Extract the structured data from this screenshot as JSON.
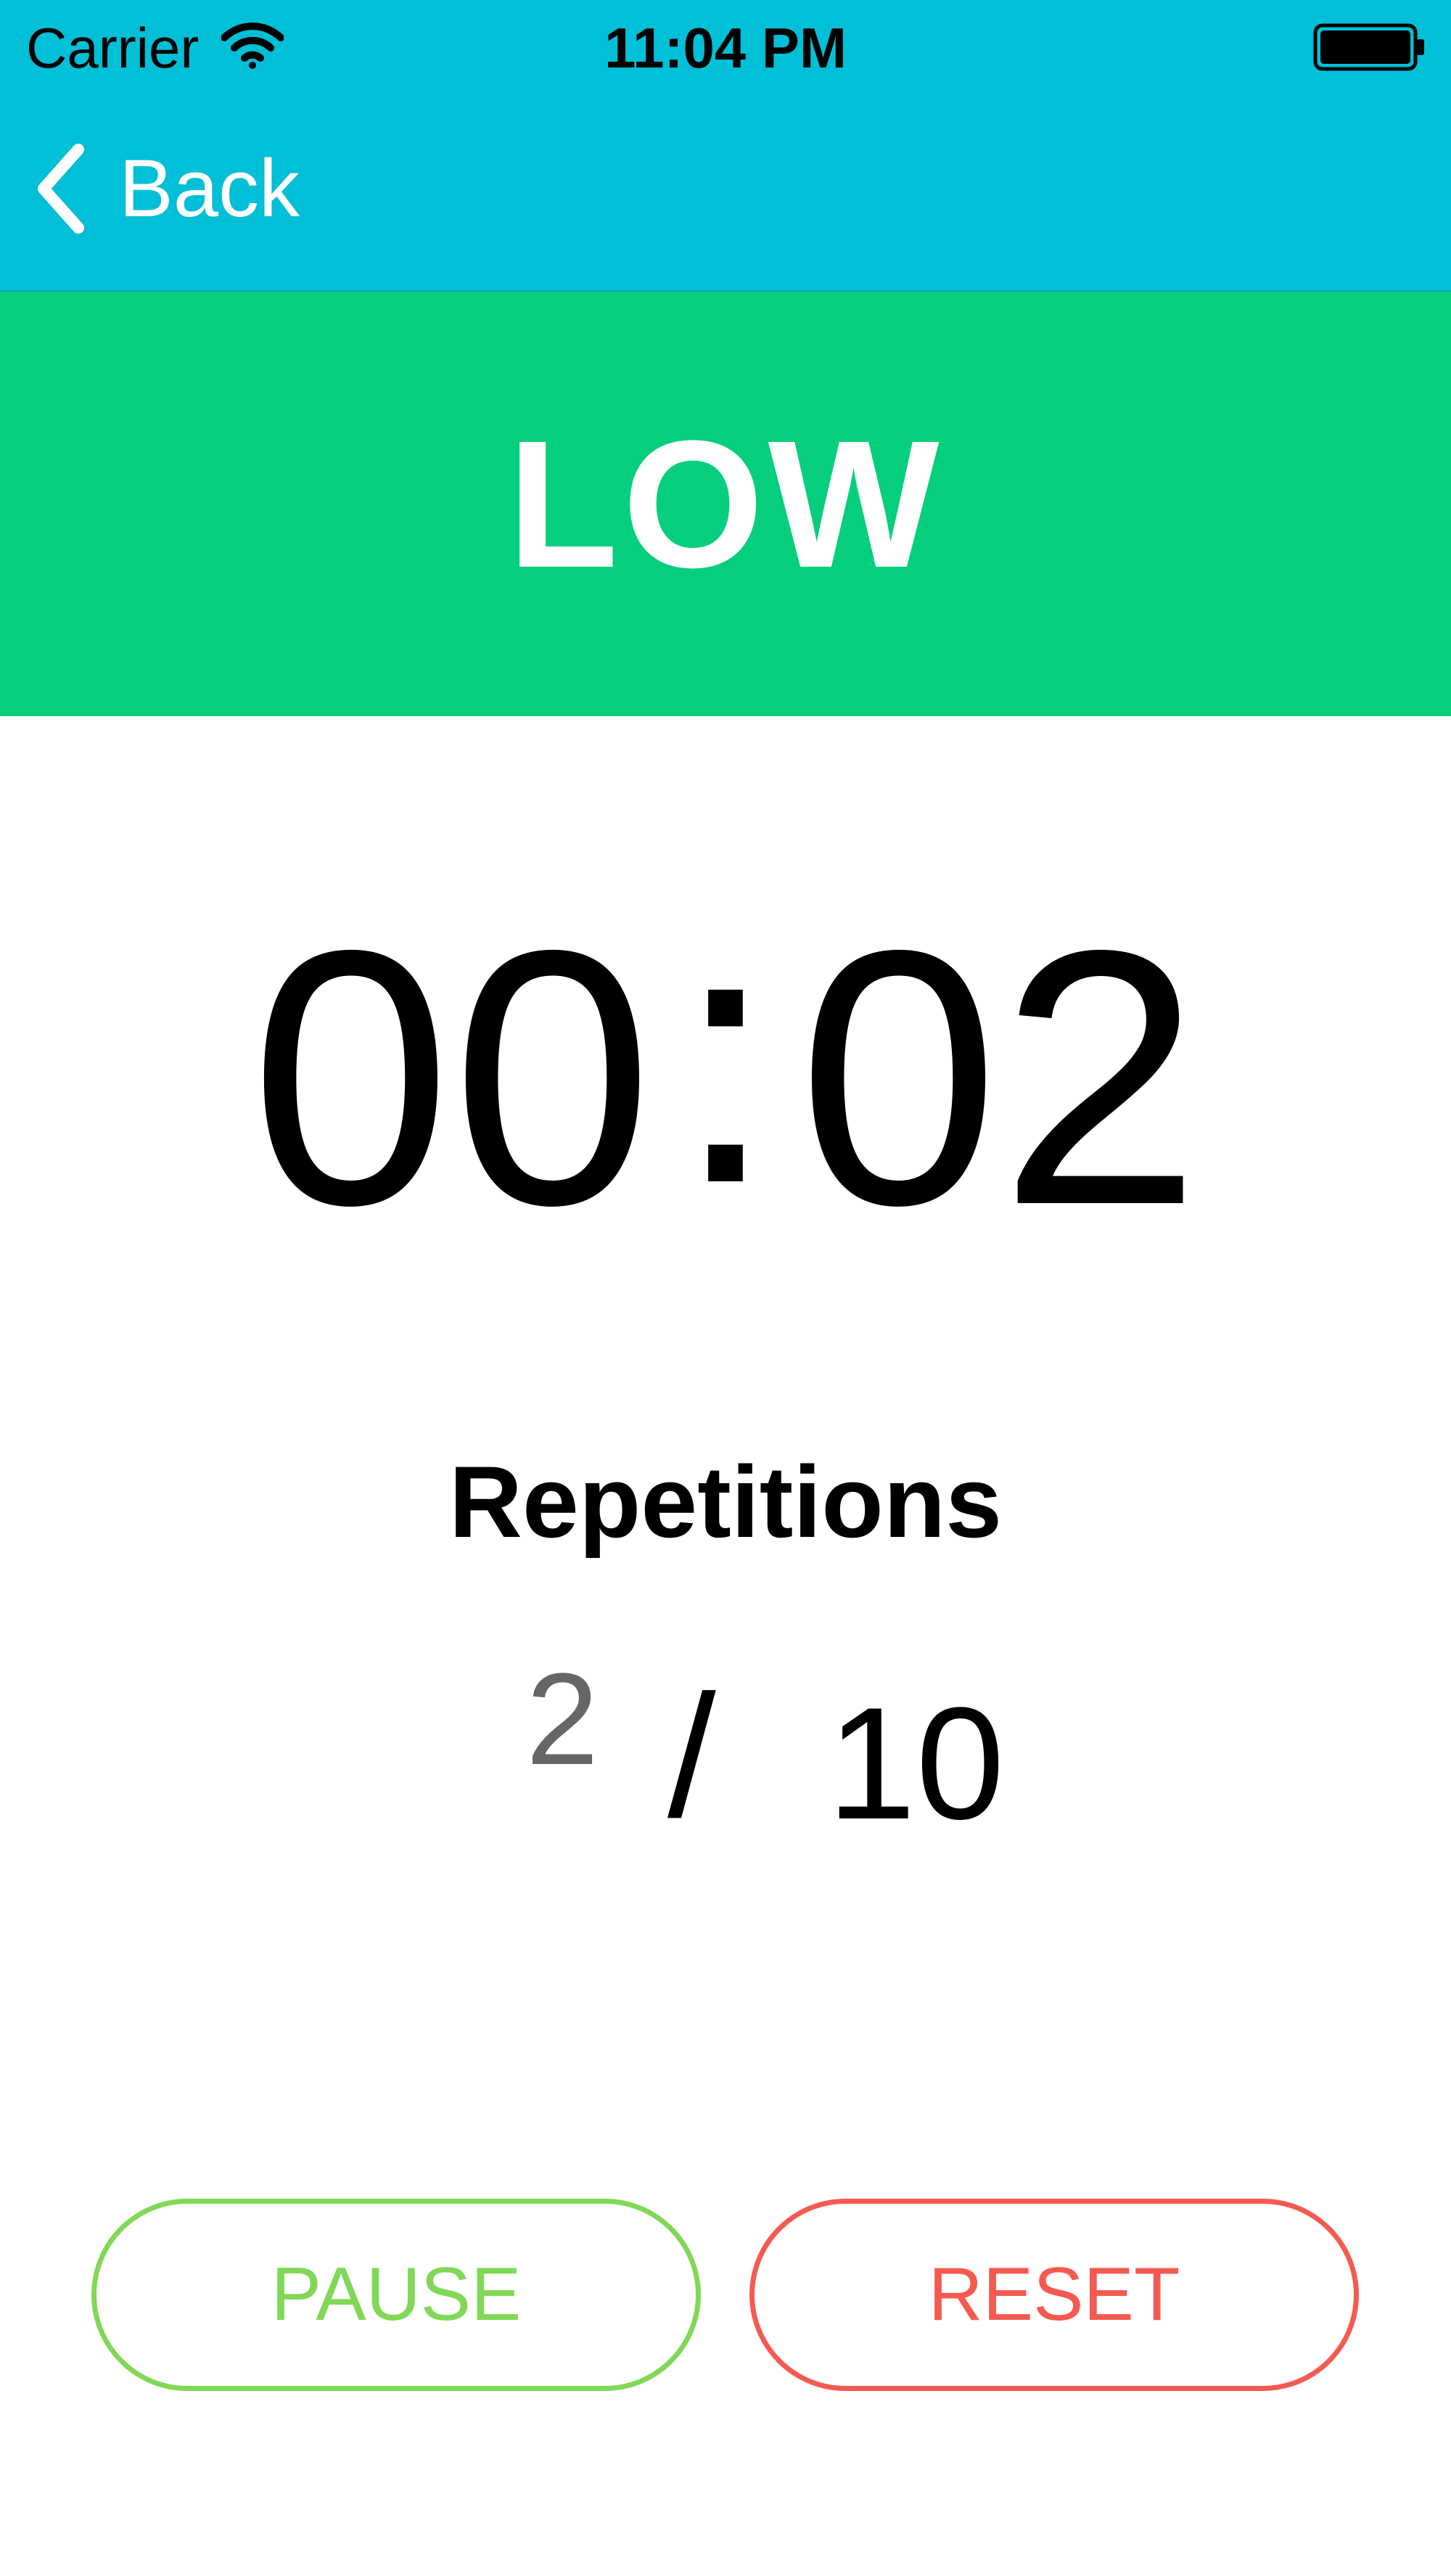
{
  "status_bar": {
    "carrier": "Carrier",
    "time": "11:04 PM",
    "wifi_icon": "wifi-icon",
    "battery_icon": "battery-icon"
  },
  "nav": {
    "back_label": "Back",
    "back_icon": "chevron-left-icon",
    "color": "#00bfd7"
  },
  "intensity": {
    "label": "LOW",
    "color": "#05cf7c"
  },
  "timer": {
    "minutes": "00",
    "separator": ":",
    "seconds": "02"
  },
  "repetitions": {
    "title": "Repetitions",
    "current": "2",
    "separator": "/",
    "total": "10"
  },
  "buttons": {
    "pause_label": "PAUSE",
    "pause_color": "#81d857",
    "reset_label": "RESET",
    "reset_color": "#f55a51"
  }
}
